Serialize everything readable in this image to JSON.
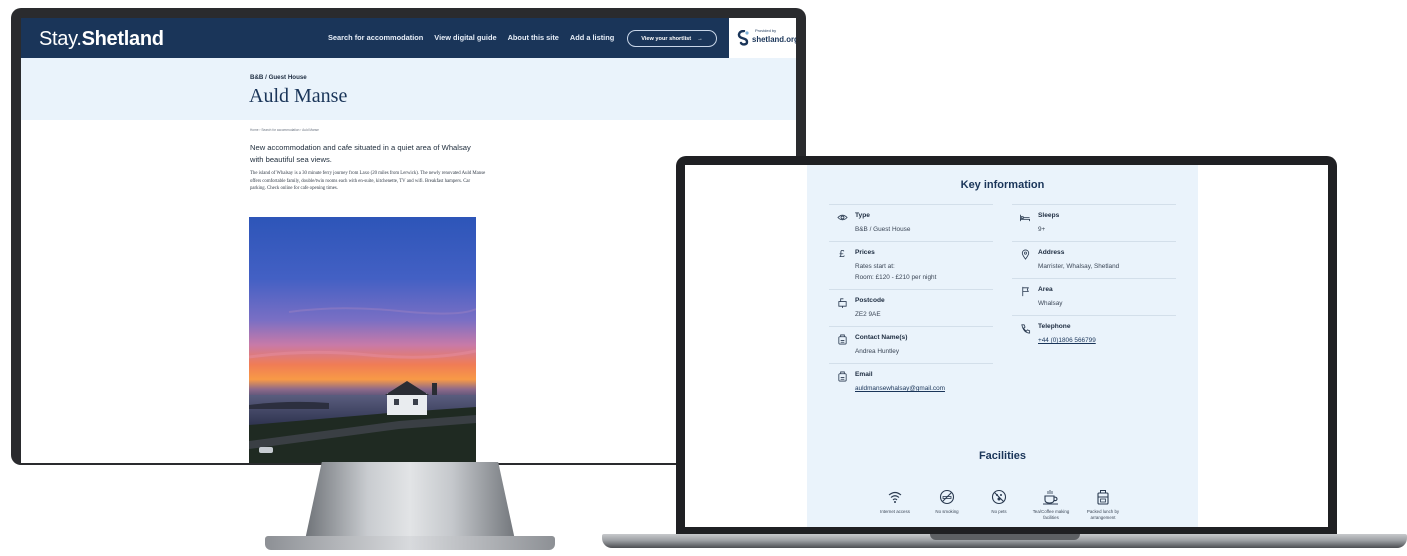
{
  "monitor": {
    "nav": {
      "logo_light": "Stay.",
      "logo_bold": "Shetland",
      "links": [
        "Search for accommodation",
        "View digital guide",
        "About this site",
        "Add a listing"
      ],
      "shortlist_label": "View your shortlist",
      "shortlist_arrow": "→",
      "provided_by": "Provided by",
      "provider": "shetland.org"
    },
    "page": {
      "category": "B&B / Guest House",
      "title": "Auld Manse",
      "breadcrumb": "Home  ›  Search for accommodation  ›  Auld Manse",
      "lead": "New accommodation and cafe situated in a quiet area of Whalsay with beautiful sea views.",
      "body": "The island of Whalsay is a 30 minute ferry journey from Laxo (20 miles from Lerwick). The newly renovated Auld Manse offers comfortable family, double/twin rooms each with en-suite, kitchenette, TV and wifi. Breakfast hampers. Car parking. Check online for cafe opening times."
    }
  },
  "laptop": {
    "key_info_heading": "Key information",
    "left_rows": [
      {
        "icon": "eye-icon",
        "label": "Type",
        "values": [
          "B&B / Guest House"
        ]
      },
      {
        "icon": "pound-icon",
        "label": "Prices",
        "values": [
          "Rates start at:",
          "Room: £120 - £210 per night"
        ]
      },
      {
        "icon": "mailbox-icon",
        "label": "Postcode",
        "values": [
          "ZE2 9AE"
        ]
      },
      {
        "icon": "contact-icon",
        "label": "Contact Name(s)",
        "values": [
          "Andrea Huntley"
        ]
      },
      {
        "icon": "email-icon",
        "label": "Email",
        "values": [
          "auldmansewhalsay@gmail.com"
        ],
        "link": true
      }
    ],
    "right_rows": [
      {
        "icon": "bed-icon",
        "label": "Sleeps",
        "values": [
          "9+"
        ]
      },
      {
        "icon": "pin-icon",
        "label": "Address",
        "values": [
          "Marrister, Whalsay, Shetland"
        ]
      },
      {
        "icon": "flag-icon",
        "label": "Area",
        "values": [
          "Whalsay"
        ]
      },
      {
        "icon": "phone-icon",
        "label": "Telephone",
        "values": [
          "+44 (0)1806 566799"
        ],
        "link": true
      }
    ],
    "facilities_heading": "Facilities",
    "facilities": [
      {
        "icon": "wifi-icon",
        "label": "Internet access"
      },
      {
        "icon": "no-smoking-icon",
        "label": "No smoking"
      },
      {
        "icon": "no-pets-icon",
        "label": "No pets"
      },
      {
        "icon": "tea-cup-icon",
        "label": "Tea/Coffee making facilities"
      },
      {
        "icon": "lunch-box-icon",
        "label": "Packed lunch by arrangement"
      }
    ]
  }
}
